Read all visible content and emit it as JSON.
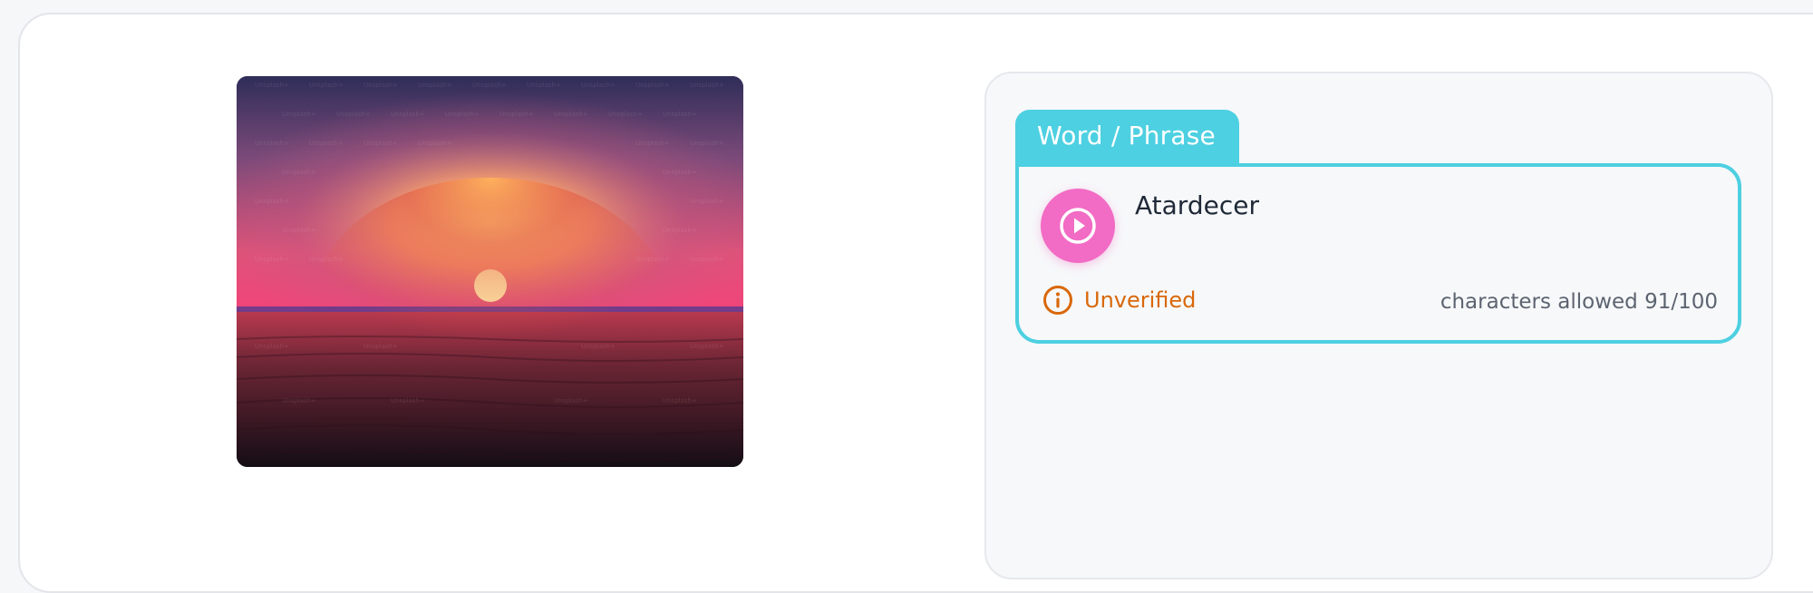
{
  "image": {
    "alt": "sunset-over-ocean",
    "watermark": "Unsplash+"
  },
  "word_tab": {
    "label": "Word / Phrase"
  },
  "word_card": {
    "word": "Atardecer",
    "status": "Unverified",
    "char_count_label": "characters allowed 91/100"
  },
  "icons": {
    "play": "play-circle-icon",
    "status": "info-circle-icon"
  },
  "colors": {
    "accent": "#4dd0e1",
    "play_button": "#f26bc4",
    "warning": "#d9680a"
  }
}
